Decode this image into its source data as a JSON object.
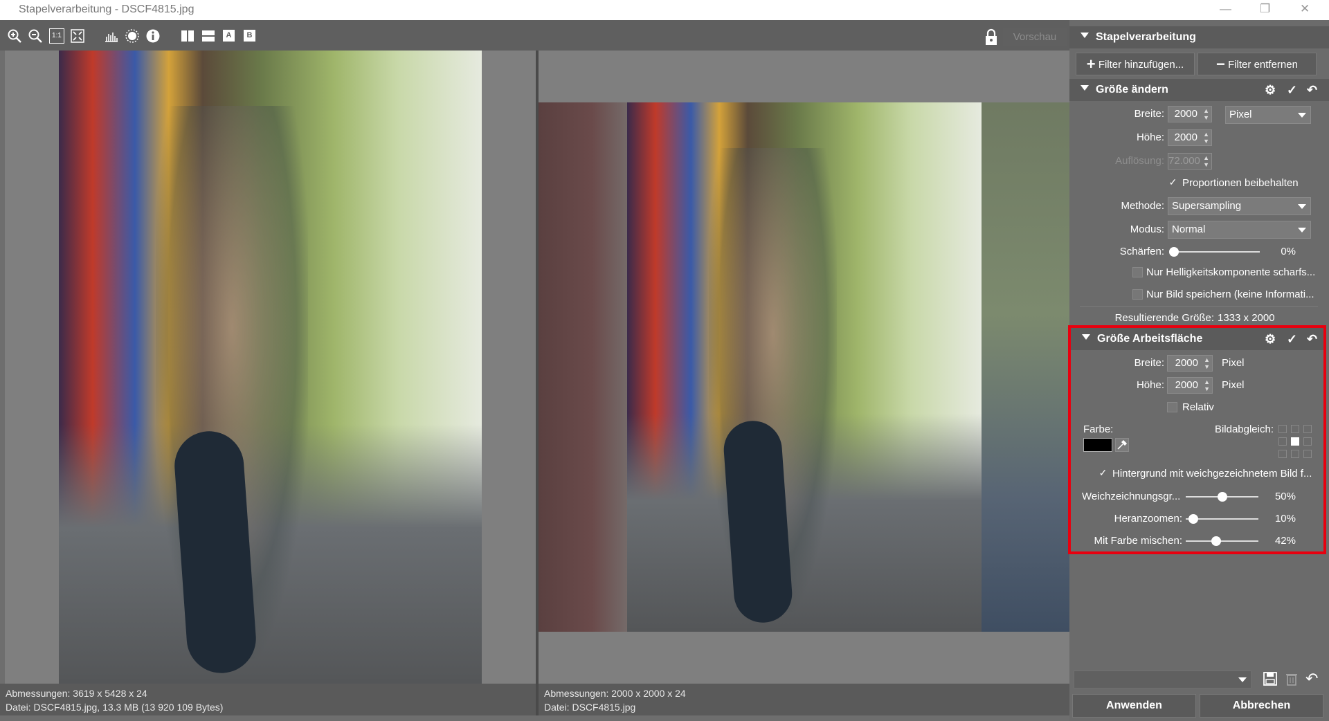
{
  "window": {
    "title": "Stapelverarbeitung - DSCF4815.jpg",
    "minimize": "—",
    "restore": "❐",
    "close": "✕"
  },
  "toolbar": {
    "preview_label": "Vorschau",
    "one_to_one": "1:1",
    "a": "A",
    "b": "B"
  },
  "left_pane": {
    "dimensions": "Abmessungen: 3619 x 5428 x 24",
    "file": "Datei: DSCF4815.jpg, 13.3 MB (13 920 109 Bytes)"
  },
  "right_pane": {
    "dimensions": "Abmessungen: 2000 x 2000 x 24",
    "file": "Datei: DSCF4815.jpg"
  },
  "panel": {
    "header": "Stapelverarbeitung",
    "add_filter": "Filter hinzufügen...",
    "remove_filter": "Filter entfernen",
    "resize": {
      "title": "Größe ändern",
      "width_label": "Breite:",
      "width_value": "2000",
      "unit": "Pixel",
      "height_label": "Höhe:",
      "height_value": "2000",
      "resolution_label": "Auflösung:",
      "resolution_value": "72.000",
      "keep_proportions": "Proportionen beibehalten",
      "method_label": "Methode:",
      "method_value": "Supersampling",
      "mode_label": "Modus:",
      "mode_value": "Normal",
      "sharpen_label": "Schärfen:",
      "sharpen_value": "0%",
      "sharpen_level": 0,
      "luma_only": "Nur Helligkeitskomponente scharfs...",
      "image_only": "Nur Bild speichern (keine Informati...",
      "result_label": "Resultierende Größe:",
      "result_value": "1333 x 2000"
    },
    "canvas": {
      "title": "Größe Arbeitsfläche",
      "width_label": "Breite:",
      "width_value": "2000",
      "width_unit": "Pixel",
      "height_label": "Höhe:",
      "height_value": "2000",
      "height_unit": "Pixel",
      "relative": "Relativ",
      "color_label": "Farbe:",
      "color_value": "#000000",
      "alignment_label": "Bildabgleich:",
      "blur_bg": "Hintergrund mit weichgezeichnetem Bild f...",
      "blur_size_label": "Weichzeichnungsgr...",
      "blur_size_value": "50%",
      "blur_size_level": 0.5,
      "zoom_label": "Heranzoomen:",
      "zoom_value": "10%",
      "zoom_level": 0.1,
      "mix_label": "Mit Farbe mischen:",
      "mix_value": "42%",
      "mix_level": 0.42
    },
    "apply": "Anwenden",
    "cancel": "Abbrechen"
  },
  "colors": {
    "accent_highlight": "#e8000f",
    "panel_bg": "#6b6b6b"
  }
}
